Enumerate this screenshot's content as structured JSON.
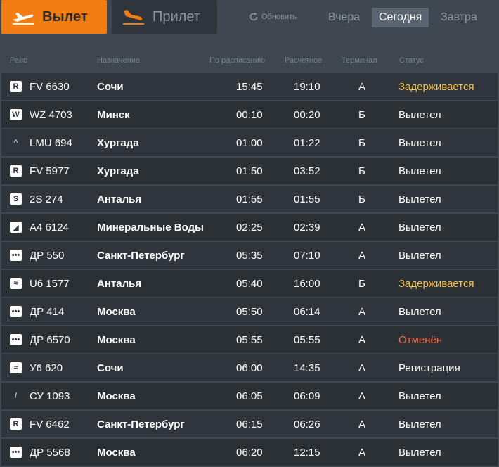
{
  "tabs": {
    "departures": "Вылет",
    "arrivals": "Прилет"
  },
  "refresh_label": "Обновить",
  "days": {
    "yesterday": "Вчера",
    "today": "Сегодня",
    "tomorrow": "Завтра"
  },
  "columns": {
    "flight": "Рейс",
    "destination": "Назначение",
    "scheduled": "По расписанию",
    "estimated": "Расчетное",
    "terminal": "Терминал",
    "status": "Статус"
  },
  "colors": {
    "accent": "#f47d13",
    "delayed": "#f2c14e",
    "cancelled": "#f26d50"
  },
  "flights": [
    {
      "logo": "R",
      "flight": "FV 6630",
      "destination": "Сочи",
      "scheduled": "15:45",
      "estimated": "19:10",
      "terminal": "А",
      "status": "Задерживается",
      "status_type": "delayed"
    },
    {
      "logo": "W",
      "flight": "WZ 4703",
      "destination": "Минск",
      "scheduled": "00:10",
      "estimated": "00:20",
      "terminal": "Б",
      "status": "Вылетел",
      "status_type": "normal"
    },
    {
      "logo": "^",
      "flight": "LMU 694",
      "destination": "Хургада",
      "scheduled": "01:00",
      "estimated": "01:22",
      "terminal": "Б",
      "status": "Вылетел",
      "status_type": "normal"
    },
    {
      "logo": "R",
      "flight": "FV 5977",
      "destination": "Хургада",
      "scheduled": "01:50",
      "estimated": "03:52",
      "terminal": "Б",
      "status": "Вылетел",
      "status_type": "normal"
    },
    {
      "logo": "S",
      "flight": "2S 274",
      "destination": "Анталья",
      "scheduled": "01:55",
      "estimated": "01:55",
      "terminal": "Б",
      "status": "Вылетел",
      "status_type": "normal"
    },
    {
      "logo": "◢",
      "flight": "A4 6124",
      "destination": "Минеральные Воды",
      "scheduled": "02:25",
      "estimated": "02:39",
      "terminal": "А",
      "status": "Вылетел",
      "status_type": "normal"
    },
    {
      "logo": "•••",
      "flight": "ДР 550",
      "destination": "Санкт-Петербург",
      "scheduled": "05:35",
      "estimated": "07:10",
      "terminal": "А",
      "status": "Вылетел",
      "status_type": "normal"
    },
    {
      "logo": "≈",
      "flight": "U6 1577",
      "destination": "Анталья",
      "scheduled": "05:40",
      "estimated": "16:00",
      "terminal": "Б",
      "status": "Задерживается",
      "status_type": "delayed"
    },
    {
      "logo": "•••",
      "flight": "ДР 414",
      "destination": "Москва",
      "scheduled": "05:50",
      "estimated": "06:14",
      "terminal": "А",
      "status": "Вылетел",
      "status_type": "normal"
    },
    {
      "logo": "•••",
      "flight": "ДР 6570",
      "destination": "Москва",
      "scheduled": "05:55",
      "estimated": "05:55",
      "terminal": "А",
      "status": "Отменён",
      "status_type": "cancelled"
    },
    {
      "logo": "≈",
      "flight": "У6 620",
      "destination": "Сочи",
      "scheduled": "06:00",
      "estimated": "14:35",
      "terminal": "А",
      "status": "Регистрация",
      "status_type": "normal"
    },
    {
      "logo": "/",
      "flight": "СУ 1093",
      "destination": "Москва",
      "scheduled": "06:05",
      "estimated": "06:09",
      "terminal": "А",
      "status": "Вылетел",
      "status_type": "normal"
    },
    {
      "logo": "R",
      "flight": "FV 6462",
      "destination": "Санкт-Петербург",
      "scheduled": "06:15",
      "estimated": "06:26",
      "terminal": "А",
      "status": "Вылетел",
      "status_type": "normal"
    },
    {
      "logo": "•••",
      "flight": "ДР 5568",
      "destination": "Москва",
      "scheduled": "06:20",
      "estimated": "12:15",
      "terminal": "А",
      "status": "Вылетел",
      "status_type": "normal"
    }
  ]
}
